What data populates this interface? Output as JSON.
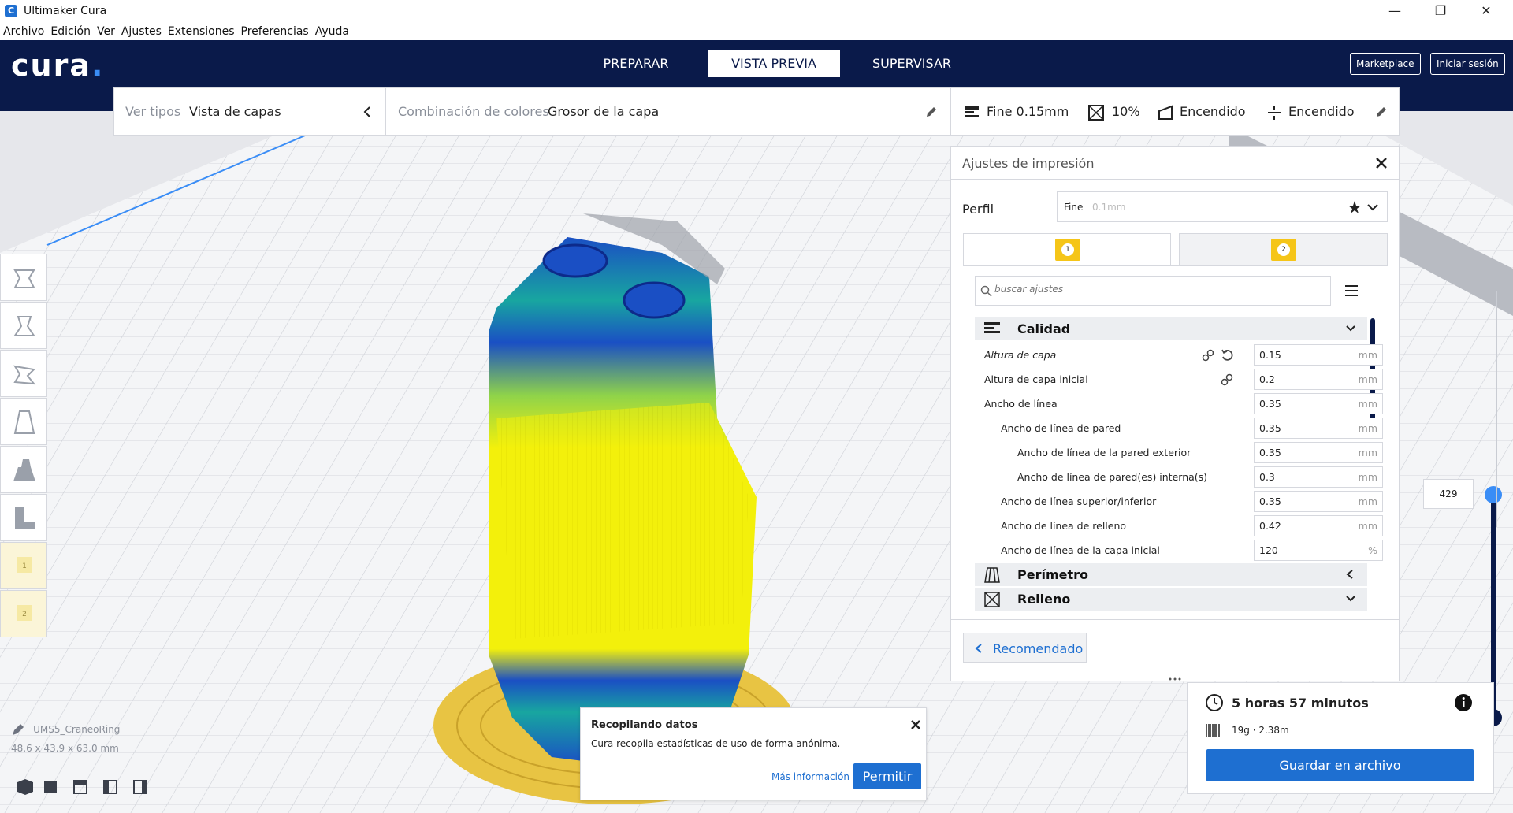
{
  "window": {
    "title": "Ultimaker Cura",
    "minimize": "—",
    "maximize": "❐",
    "close": "✕"
  },
  "menu": [
    "Archivo",
    "Edición",
    "Ver",
    "Ajustes",
    "Extensiones",
    "Preferencias",
    "Ayuda"
  ],
  "header": {
    "logo": "cura",
    "logo_dot": ".",
    "tabs": [
      "PREPARAR",
      "VISTA PREVIA",
      "SUPERVISAR"
    ],
    "active_tab": "VISTA PREVIA",
    "marketplace": "Marketplace",
    "signin": "Iniciar sesión"
  },
  "view": {
    "type_label": "Ver tipos",
    "type_value": "Vista de capas"
  },
  "color_scheme": {
    "label": "Combinación de colores",
    "value": "Grosor de la capa"
  },
  "settings_bar": {
    "profile": "Fine 0.15mm",
    "infill": "10%",
    "support": "Encendido",
    "adhesion": "Encendido"
  },
  "print_settings": {
    "title": "Ajustes de impresión",
    "profile_label": "Perfil",
    "profile_value": "Fine",
    "profile_sub": "0.1mm",
    "extruder_tabs": [
      "1",
      "2"
    ],
    "search_placeholder": "buscar ajustes",
    "categories": {
      "quality": "Calidad",
      "perimeter": "Perímetro",
      "infill": "Relleno"
    },
    "rows": [
      {
        "label": "Altura de capa",
        "value": "0.15",
        "unit": "mm"
      },
      {
        "label": "Altura de capa inicial",
        "value": "0.2",
        "unit": "mm"
      },
      {
        "label": "Ancho de línea",
        "value": "0.35",
        "unit": "mm"
      },
      {
        "label": "Ancho de línea de pared",
        "value": "0.35",
        "unit": "mm"
      },
      {
        "label": "Ancho de línea de la pared exterior",
        "value": "0.35",
        "unit": "mm"
      },
      {
        "label": "Ancho de línea de pared(es) interna(s)",
        "value": "0.3",
        "unit": "mm"
      },
      {
        "label": "Ancho de línea superior/inferior",
        "value": "0.35",
        "unit": "mm"
      },
      {
        "label": "Ancho de línea de relleno",
        "value": "0.42",
        "unit": "mm"
      },
      {
        "label": "Ancho de línea de la capa inicial",
        "value": "120",
        "unit": "%"
      }
    ],
    "recommended": "Recomendado"
  },
  "layer_slider": {
    "value": "429"
  },
  "object": {
    "name": "UMS5_CraneoRing",
    "dimensions": "48.6 x 43.9 x 63.0 mm"
  },
  "output": {
    "time": "5 horas 57 minutos",
    "material": "19g · 2.38m",
    "save": "Guardar en archivo"
  },
  "toast": {
    "title": "Recopilando datos",
    "body": "Cura recopila estadísticas de uso de forma anónima.",
    "more": "Más información",
    "allow": "Permitir"
  },
  "colors": {
    "header_bg": "#0a1a4a",
    "accent": "#1e6fd1",
    "layer_yellow": "#f3f00b",
    "layer_blue": "#1a4fc4",
    "layer_teal": "#18a6a0",
    "skirt_yellow": "#e8c443"
  }
}
